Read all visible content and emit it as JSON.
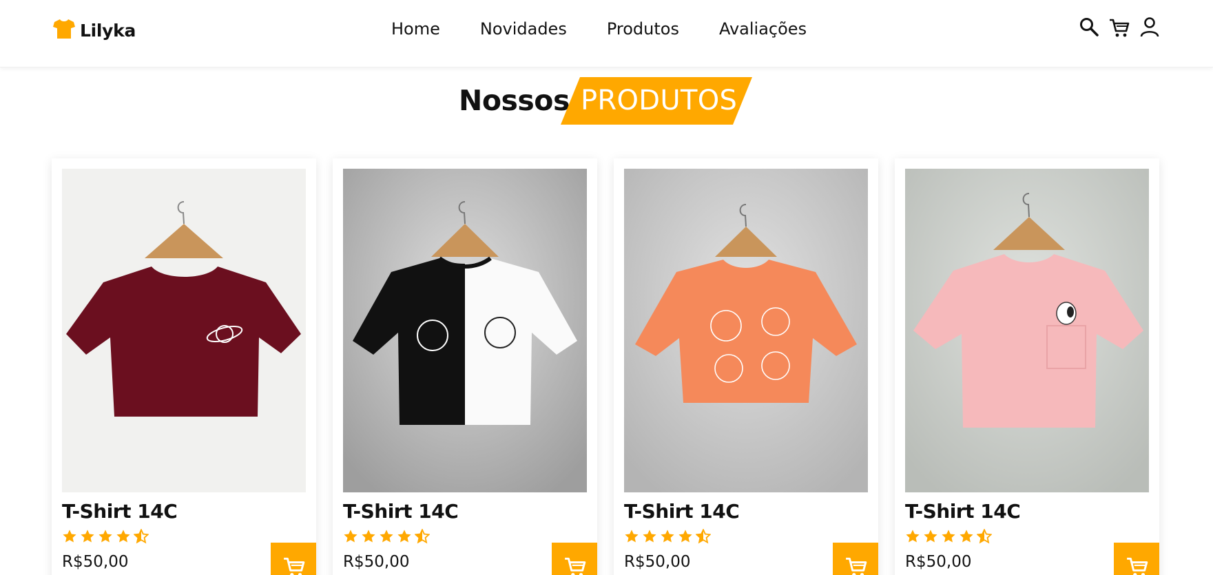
{
  "brand": {
    "name": "Lilyka",
    "logo_icon": "tshirt-icon",
    "accent_color": "#ffa800"
  },
  "nav": {
    "items": [
      {
        "label": "Home"
      },
      {
        "label": "Novidades"
      },
      {
        "label": "Produtos"
      },
      {
        "label": "Avaliações"
      }
    ]
  },
  "header_icons": [
    "search-icon",
    "cart-icon",
    "user-icon"
  ],
  "section": {
    "title_plain": "Nossos",
    "title_highlight": "PRODUTOS"
  },
  "products": [
    {
      "name": "T-Shirt 14C",
      "price": "R$50,00",
      "rating": 4.5,
      "rating_max": 5,
      "image": "burgundy crop t-shirt with planet print"
    },
    {
      "name": "T-Shirt 14C",
      "price": "R$50,00",
      "rating": 4.5,
      "rating_max": 5,
      "image": "black and white crop t-shirt with moon and sun print"
    },
    {
      "name": "T-Shirt 14C",
      "price": "R$50,00",
      "rating": 4.5,
      "rating_max": 5,
      "image": "orange crop t-shirt with sun and moon print"
    },
    {
      "name": "T-Shirt 14C",
      "price": "R$50,00",
      "rating": 4.5,
      "rating_max": 5,
      "image": "pink crop t-shirt with pocket and dog"
    }
  ]
}
